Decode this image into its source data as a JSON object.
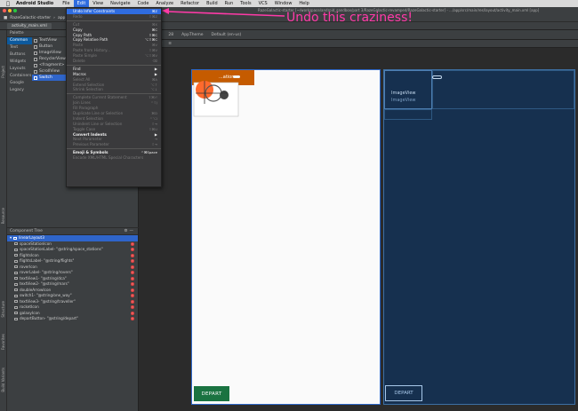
{
  "menubar": {
    "app": "Android Studio",
    "items": [
      "File",
      "Edit",
      "View",
      "Navigate",
      "Code",
      "Analyze",
      "Refactor",
      "Build",
      "Run",
      "Tools",
      "VCS",
      "Window",
      "Help"
    ],
    "active": "Edit"
  },
  "window": {
    "title": "RazeGalactic-starter [~/workspace/android_sandbox/part 3/RazeGalactic-revamped/RazeGalactic-starter] - .../app/src/main/res/layout/activity_main.xml [app]"
  },
  "navbar": {
    "crumbs": [
      "RazeGalactic-starter",
      "app"
    ]
  },
  "tabs": {
    "file": "activity_main.xml"
  },
  "palette": {
    "title": "Palette",
    "categories": [
      "Common",
      "Text",
      "Buttons",
      "Widgets",
      "Layouts",
      "Containers",
      "Google",
      "Legacy"
    ],
    "widgets": [
      "TextView",
      "Button",
      "ImageView",
      "RecyclerView",
      "<fragment>",
      "ScrollView",
      "Switch"
    ],
    "selected_widget": "Switch"
  },
  "tree": {
    "title": "Component Tree",
    "root": "linearLayout3",
    "rows": [
      "spaceStationIcon",
      "spaceStationLabel- \"@string/space_stations\"",
      "flightsIcon",
      "flightsLabel- \"@string/flights\"",
      "roverIcon",
      "roverLabel- \"@string/rovers\"",
      "textView1- \"@string/dca\"",
      "textView2- \"@string/mars\"",
      "doubleArrowIcon",
      "switch1- \"@string/one_way\"",
      "textView3- \"@string/traveller\"",
      "rocketIcon",
      "galaxyIcon",
      "departButton- \"@string/depart\""
    ]
  },
  "editor_toolbar": {
    "items": [
      "Pixel",
      "28",
      "AppTheme",
      "Default (en-us)"
    ]
  },
  "design": {
    "station_label": "...ations",
    "depart_label": "DEPART"
  },
  "blueprint": {
    "image_label": "ImageView",
    "image_label_ghost": "ImageView",
    "depart_label": "DEPART"
  },
  "edit_menu": {
    "items": [
      {
        "label": "Undo Infer Constraints",
        "shortcut": "⌘Z",
        "state": "highlighted"
      },
      {
        "label": "Redo",
        "shortcut": "⇧⌘Z",
        "state": "disabled"
      },
      {
        "sep": true
      },
      {
        "label": "Cut",
        "shortcut": "⌘X",
        "state": "disabled"
      },
      {
        "label": "Copy",
        "shortcut": "⌘C",
        "state": "enabled"
      },
      {
        "label": "Copy Path",
        "shortcut": "⇧⌘C",
        "state": "enabled"
      },
      {
        "label": "Copy Relative Path",
        "shortcut": "⌥⇧⌘C",
        "state": "enabled"
      },
      {
        "label": "Paste",
        "shortcut": "⌘V",
        "state": "disabled"
      },
      {
        "label": "Paste from History...",
        "shortcut": "⇧⌘V",
        "state": "disabled"
      },
      {
        "label": "Paste Simple",
        "shortcut": "⌥⇧⌘V",
        "state": "disabled"
      },
      {
        "label": "Delete",
        "shortcut": "⌫",
        "state": "disabled"
      },
      {
        "sep": true
      },
      {
        "label": "Find",
        "submenu": true,
        "state": "enabled"
      },
      {
        "label": "Macros",
        "submenu": true,
        "state": "enabled"
      },
      {
        "label": "Select All",
        "shortcut": "⌘A",
        "state": "disabled"
      },
      {
        "label": "Extend Selection",
        "shortcut": "⌥↑",
        "state": "disabled"
      },
      {
        "label": "Shrink Selection",
        "shortcut": "⌥↓",
        "state": "disabled"
      },
      {
        "sep": true
      },
      {
        "label": "Complete Current Statement",
        "shortcut": "⇧⌘⏎",
        "state": "disabled"
      },
      {
        "label": "Join Lines",
        "shortcut": "^⇧J",
        "state": "disabled"
      },
      {
        "label": "Fill Paragraph",
        "shortcut": "",
        "state": "disabled"
      },
      {
        "label": "Duplicate Line or Selection",
        "shortcut": "⌘D",
        "state": "disabled"
      },
      {
        "label": "Indent Selection",
        "shortcut": "^⌥I",
        "state": "disabled"
      },
      {
        "label": "Unindent Line or Selection",
        "shortcut": "⇧⇥",
        "state": "disabled"
      },
      {
        "label": "Toggle Case",
        "shortcut": "⇧⌘U",
        "state": "disabled"
      },
      {
        "label": "Convert Indents",
        "submenu": true,
        "state": "bold"
      },
      {
        "label": "Next Parameter",
        "shortcut": "⇥",
        "state": "disabled"
      },
      {
        "label": "Previous Parameter",
        "shortcut": "⇧⇥",
        "state": "disabled"
      },
      {
        "sep": true
      },
      {
        "label": "Emoji & Symbols",
        "shortcut": "^⌘Space",
        "state": "bold"
      },
      {
        "label": "Encode XML/HTML Special Characters",
        "shortcut": "",
        "state": "disabled"
      }
    ]
  },
  "annotation": {
    "text": "Undo this craziness!",
    "color": "#ff3aa8"
  },
  "colors": {
    "highlight": "#2f6ce0",
    "depart_green": "#1a7341",
    "station_orange": "#c55b00",
    "blueprint_bg": "#16304f"
  }
}
